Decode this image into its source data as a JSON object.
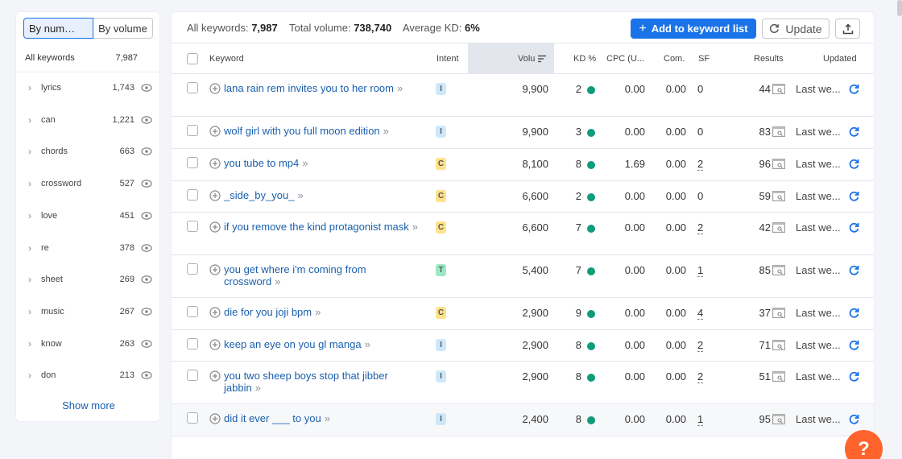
{
  "sidebar": {
    "by_number": "By num…",
    "by_volume": "By volume",
    "all_keywords_label": "All keywords",
    "all_keywords_count": "7,987",
    "show_more": "Show more",
    "groups": [
      {
        "name": "lyrics",
        "count": "1,743"
      },
      {
        "name": "can",
        "count": "1,221"
      },
      {
        "name": "chords",
        "count": "663"
      },
      {
        "name": "crossword",
        "count": "527"
      },
      {
        "name": "love",
        "count": "451"
      },
      {
        "name": "re",
        "count": "378"
      },
      {
        "name": "sheet",
        "count": "269"
      },
      {
        "name": "music",
        "count": "267"
      },
      {
        "name": "know",
        "count": "263"
      },
      {
        "name": "don",
        "count": "213"
      }
    ]
  },
  "summary": {
    "all_label": "All keywords:",
    "all_value": "7,987",
    "vol_label": "Total volume:",
    "vol_value": "738,740",
    "kd_label": "Average KD:",
    "kd_value": "6%"
  },
  "toolbar": {
    "add_label": "Add to keyword list",
    "update_label": "Update",
    "export_icon": "export-icon"
  },
  "columns": {
    "keyword": "Keyword",
    "intent": "Intent",
    "volume": "Volu",
    "kd": "KD %",
    "cpc": "CPC (U...",
    "com": "Com.",
    "sf": "SF",
    "results": "Results",
    "updated": "Updated"
  },
  "intent_colors": {
    "I": "#cde8fb",
    "C": "#ffe28a",
    "T": "#9ce8c4"
  },
  "rows": [
    {
      "keyword": "lana rain rem invites you to her room",
      "intent": "I",
      "volume": "9,900",
      "kd": "2",
      "cpc": "0.00",
      "com": "0.00",
      "sf": "0",
      "results": "44",
      "updated": "Last we..."
    },
    {
      "keyword": "wolf girl with you full moon edition",
      "intent": "I",
      "volume": "9,900",
      "kd": "3",
      "cpc": "0.00",
      "com": "0.00",
      "sf": "0",
      "results": "83",
      "updated": "Last we..."
    },
    {
      "keyword": "you tube to mp4",
      "intent": "C",
      "volume": "8,100",
      "kd": "8",
      "cpc": "1.69",
      "com": "0.00",
      "sf": "2",
      "results": "96",
      "updated": "Last we..."
    },
    {
      "keyword": "_side_by_you_",
      "intent": "C",
      "volume": "6,600",
      "kd": "2",
      "cpc": "0.00",
      "com": "0.00",
      "sf": "0",
      "results": "59",
      "updated": "Last we..."
    },
    {
      "keyword": "if you remove the kind protagonist mask",
      "intent": "C",
      "volume": "6,600",
      "kd": "7",
      "cpc": "0.00",
      "com": "0.00",
      "sf": "2",
      "results": "42",
      "updated": "Last we..."
    },
    {
      "keyword": "you get where i'm coming from crossword",
      "intent": "T",
      "volume": "5,400",
      "kd": "7",
      "cpc": "0.00",
      "com": "0.00",
      "sf": "1",
      "results": "85",
      "updated": "Last we..."
    },
    {
      "keyword": "die for you joji bpm",
      "intent": "C",
      "volume": "2,900",
      "kd": "9",
      "cpc": "0.00",
      "com": "0.00",
      "sf": "4",
      "results": "37",
      "updated": "Last we..."
    },
    {
      "keyword": "keep an eye on you gl manga",
      "intent": "I",
      "volume": "2,900",
      "kd": "8",
      "cpc": "0.00",
      "com": "0.00",
      "sf": "2",
      "results": "71",
      "updated": "Last we..."
    },
    {
      "keyword": "you two sheep boys stop that jibber jabbin",
      "intent": "I",
      "volume": "2,900",
      "kd": "8",
      "cpc": "0.00",
      "com": "0.00",
      "sf": "2",
      "results": "51",
      "updated": "Last we..."
    },
    {
      "keyword": "did it ever ___ to you",
      "intent": "I",
      "volume": "2,400",
      "kd": "8",
      "cpc": "0.00",
      "com": "0.00",
      "sf": "1",
      "results": "95",
      "updated": "Last we..."
    }
  ],
  "help_label": "?"
}
